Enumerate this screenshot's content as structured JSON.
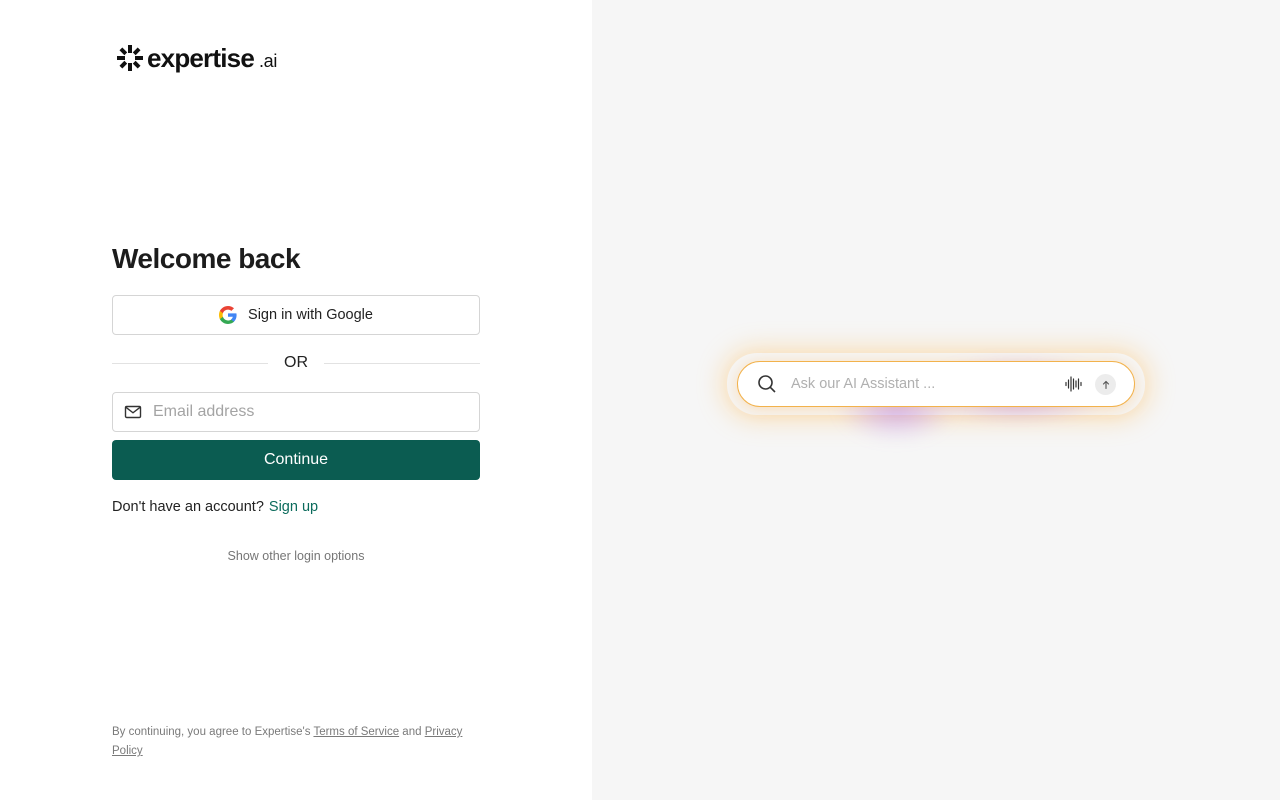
{
  "brand": {
    "name": "expertise",
    "suffix": ".ai",
    "logo_icon": "starburst-logo-icon"
  },
  "login": {
    "heading": "Welcome back",
    "google_button_label": "Sign in with Google",
    "divider_text": "OR",
    "email_placeholder": "Email address",
    "email_value": "",
    "continue_label": "Continue",
    "no_account_text": "Don't have an account?",
    "signup_label": "Sign up",
    "other_options_label": "Show other login options"
  },
  "legal": {
    "prefix": "By continuing, you agree to Expertise's",
    "terms_label": "Terms of Service",
    "and_text": "and",
    "privacy_label": "Privacy Policy"
  },
  "assistant": {
    "placeholder": "Ask our AI Assistant ...",
    "icons": [
      "search-icon",
      "voice-wave-icon",
      "arrow-up-icon"
    ]
  },
  "colors": {
    "primary": "#0b5c51",
    "link": "#0b6b5c",
    "right_panel_bg": "#f6f6f6",
    "assistant_border": "#f2b24c",
    "glow_purple": "#9650ff"
  }
}
